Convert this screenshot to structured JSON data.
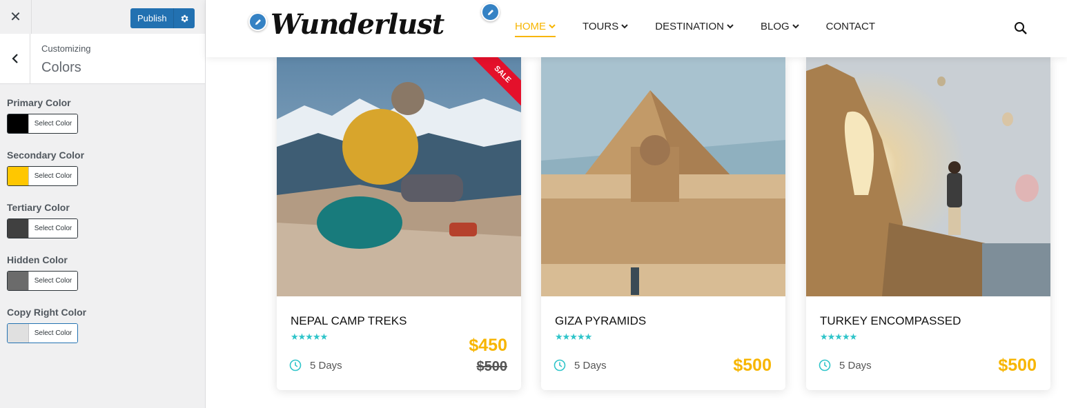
{
  "sidebar": {
    "close_icon": "close-icon",
    "publish_label": "Publish",
    "gear_icon": "gear-icon",
    "back_icon": "chevron-left-icon",
    "customizing_label": "Customizing",
    "section_title": "Colors",
    "controls": [
      {
        "label": "Primary Color",
        "button": "Select Color",
        "color": "#000000"
      },
      {
        "label": "Secondary Color",
        "button": "Select Color",
        "color": "#ffc700"
      },
      {
        "label": "Tertiary Color",
        "button": "Select Color",
        "color": "#404040"
      },
      {
        "label": "Hidden Color",
        "button": "Select Color",
        "color": "#6b6b6b"
      },
      {
        "label": "Copy Right Color",
        "button": "Select Color",
        "color": "#e0e0e0"
      }
    ]
  },
  "site": {
    "logo": "Wunderlust",
    "nav": [
      {
        "label": "HOME",
        "active": true,
        "dropdown": true
      },
      {
        "label": "TOURS",
        "active": false,
        "dropdown": true
      },
      {
        "label": "DESTINATION",
        "active": false,
        "dropdown": true
      },
      {
        "label": "BLOG",
        "active": false,
        "dropdown": true
      },
      {
        "label": "CONTACT",
        "active": false,
        "dropdown": false
      }
    ],
    "accent_color": "#f7b500",
    "star_color": "#2ec4c9"
  },
  "tours": [
    {
      "title": "NEPAL CAMP TREKS",
      "stars": "★★★★★",
      "duration": "5 Days",
      "price": "$450",
      "old_price": "$500",
      "badge": "SALE"
    },
    {
      "title": "GIZA PYRAMIDS",
      "stars": "★★★★★",
      "duration": "5 Days",
      "price": "$500"
    },
    {
      "title": "TURKEY ENCOMPASSED",
      "stars": "★★★★★",
      "duration": "5 Days",
      "price": "$500"
    }
  ]
}
